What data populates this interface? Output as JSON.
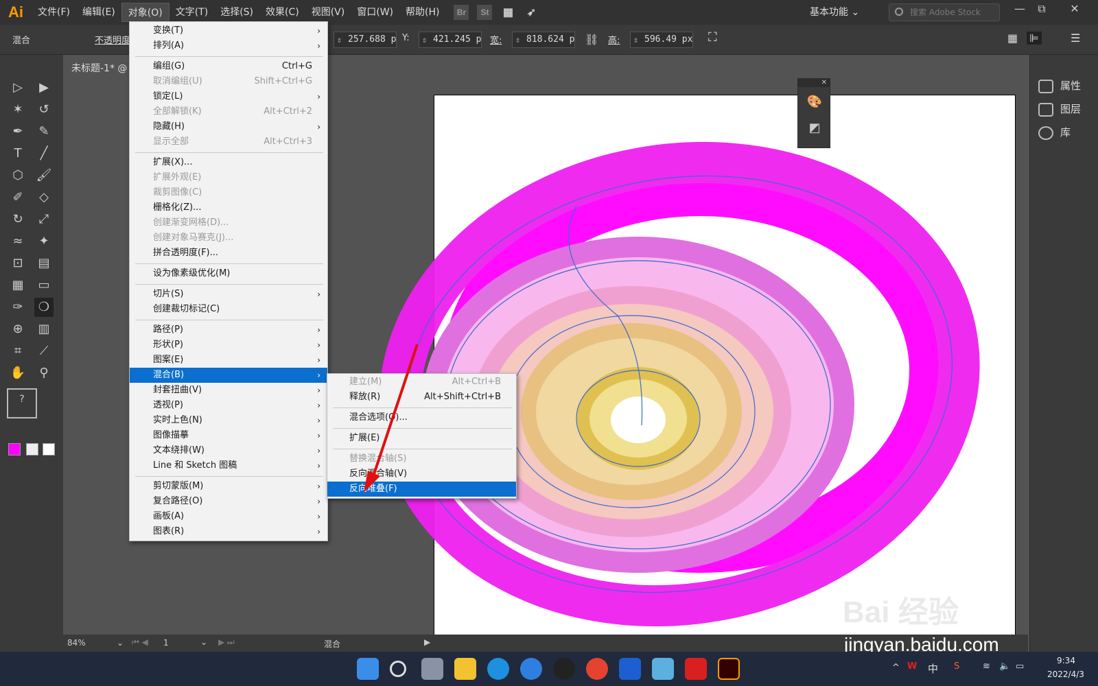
{
  "app": {
    "logo": "Ai",
    "menus": [
      "文件(F)",
      "编辑(E)",
      "对象(O)",
      "文字(T)",
      "选择(S)",
      "效果(C)",
      "视图(V)",
      "窗口(W)",
      "帮助(H)"
    ],
    "bridge": "Br",
    "stock_icon": "St",
    "workspace": "基本功能",
    "stock_placeholder": "搜索 Adobe Stock"
  },
  "control": {
    "mode": "混合",
    "opacity_label": "不透明度",
    "x_value": "257.688 p",
    "y_label": "Y:",
    "y_value": "421.245 p",
    "w_label": "宽:",
    "w_value": "818.624 p",
    "h_label": "高:",
    "h_value": "596.49 px"
  },
  "document": {
    "tab": "未标题-1* @"
  },
  "right_panel": {
    "items": [
      "属性",
      "图层",
      "库"
    ]
  },
  "status": {
    "zoom": "84%",
    "page": "1",
    "tool": "混合"
  },
  "object_menu": [
    {
      "label": "变换(T)",
      "sub": true
    },
    {
      "label": "排列(A)",
      "sub": true
    },
    {
      "sep": true
    },
    {
      "label": "编组(G)",
      "shortcut": "Ctrl+G"
    },
    {
      "label": "取消编组(U)",
      "shortcut": "Shift+Ctrl+G",
      "disabled": true
    },
    {
      "label": "锁定(L)",
      "sub": true
    },
    {
      "label": "全部解锁(K)",
      "shortcut": "Alt+Ctrl+2",
      "disabled": true
    },
    {
      "label": "隐藏(H)",
      "sub": true
    },
    {
      "label": "显示全部",
      "shortcut": "Alt+Ctrl+3",
      "disabled": true
    },
    {
      "sep": true
    },
    {
      "label": "扩展(X)..."
    },
    {
      "label": "扩展外观(E)",
      "disabled": true
    },
    {
      "label": "裁剪图像(C)",
      "disabled": true
    },
    {
      "label": "栅格化(Z)..."
    },
    {
      "label": "创建渐变网格(D)...",
      "disabled": true
    },
    {
      "label": "创建对象马赛克(J)...",
      "disabled": true
    },
    {
      "label": "拼合透明度(F)..."
    },
    {
      "sep": true
    },
    {
      "label": "设为像素级优化(M)"
    },
    {
      "sep": true
    },
    {
      "label": "切片(S)",
      "sub": true
    },
    {
      "label": "创建裁切标记(C)"
    },
    {
      "sep": true
    },
    {
      "label": "路径(P)",
      "sub": true
    },
    {
      "label": "形状(P)",
      "sub": true
    },
    {
      "label": "图案(E)",
      "sub": true
    },
    {
      "label": "混合(B)",
      "sub": true,
      "highlight": true
    },
    {
      "label": "封套扭曲(V)",
      "sub": true
    },
    {
      "label": "透视(P)",
      "sub": true
    },
    {
      "label": "实时上色(N)",
      "sub": true
    },
    {
      "label": "图像描摹",
      "sub": true
    },
    {
      "label": "文本绕排(W)",
      "sub": true
    },
    {
      "label": "Line 和 Sketch 图稿",
      "sub": true
    },
    {
      "sep": true
    },
    {
      "label": "剪切蒙版(M)",
      "sub": true
    },
    {
      "label": "复合路径(O)",
      "sub": true
    },
    {
      "label": "画板(A)",
      "sub": true
    },
    {
      "label": "图表(R)",
      "sub": true
    }
  ],
  "blend_menu": [
    {
      "label": "建立(M)",
      "shortcut": "Alt+Ctrl+B",
      "disabled": true
    },
    {
      "label": "释放(R)",
      "shortcut": "Alt+Shift+Ctrl+B"
    },
    {
      "sep": true
    },
    {
      "label": "混合选项(O)..."
    },
    {
      "sep": true
    },
    {
      "label": "扩展(E)"
    },
    {
      "sep": true
    },
    {
      "label": "替换混合轴(S)",
      "disabled": true
    },
    {
      "label": "反向混合轴(V)"
    },
    {
      "label": "反向堆叠(F)",
      "highlight": true
    }
  ],
  "taskbar": {
    "time": "9:34",
    "date": "2022/4/3",
    "ime": "中"
  },
  "watermark": {
    "line1": "Bai 经验",
    "line2": "jingyan.baidu.com"
  },
  "colors": {
    "magenta": "#ff00ff",
    "highlight": "#0b6fcf",
    "arrow": "#e01010"
  }
}
